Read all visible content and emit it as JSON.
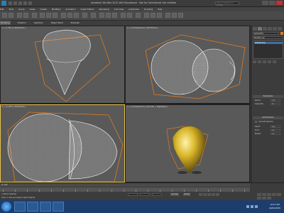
{
  "window": {
    "title": "Autodesk 3ds Max 2015 x64  Educational - Not for Commercial Use  Untitled",
    "search_placeholder": "Type a keyword or phrase"
  },
  "menubar": [
    "Edit",
    "Tools",
    "Group",
    "Views",
    "Create",
    "Modifiers",
    "Animation",
    "Graph Editors",
    "Rendering",
    "Civil View",
    "Customize",
    "Scripting",
    "Help"
  ],
  "ribbon_tabs": [
    "Modeling",
    "Freeform",
    "Selection",
    "Object Paint",
    "Populate"
  ],
  "viewports": [
    {
      "label": "[ + ] [ Top ] [ Wireframe ]"
    },
    {
      "label": "[ + ] [ Perspective ] [ Wireframe ]"
    },
    {
      "label": "[ + ] [ Left ] [ Wireframe ]"
    },
    {
      "label": "[ + ] [ Perspective ] [ Smooth + Highlights ]"
    }
  ],
  "command_panel": {
    "object_name": "Sphere001",
    "modifier_list": "Modifier List",
    "stack_item": "Editable Poly",
    "rollouts": {
      "parameters": "Parameters",
      "soft_selection": "Soft Selection"
    },
    "params": [
      {
        "label": "Radius:",
        "value": "15.0"
      },
      {
        "label": "Segments:",
        "value": "32"
      }
    ],
    "soft_params": [
      {
        "label": "Falloff:",
        "value": "20.0"
      },
      {
        "label": "Pinch:",
        "value": "0.0"
      },
      {
        "label": "Bubble:",
        "value": "0.0"
      }
    ],
    "checkbox_label": "Use Soft Selection"
  },
  "status": {
    "timeslider": "0 / 100",
    "selection": "1 Object Selected",
    "prompt": "Click or click-and-drag to select objects",
    "set_key": "Set Key",
    "auto_key": "Auto Key"
  },
  "taskbar": {
    "time": "12:17 AM",
    "date": "22/01/2015"
  },
  "colors": {
    "viewport_bg": "#595959",
    "wire": "#ffffff",
    "bbox": "#e07b20",
    "gold": "#d9b52a"
  }
}
